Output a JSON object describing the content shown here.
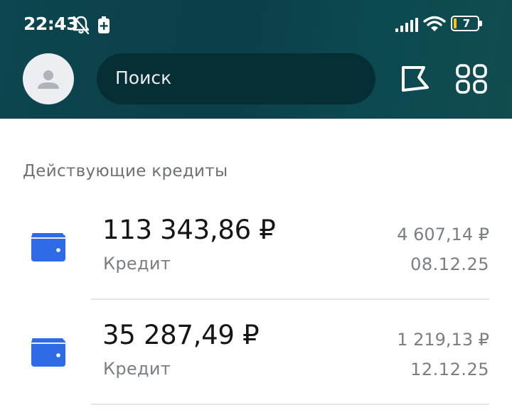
{
  "status_bar": {
    "time": "22:43",
    "battery_level": "7",
    "icons": [
      "bell-off-icon",
      "battery-saver-icon",
      "signal-icon",
      "wifi-icon",
      "battery-icon"
    ],
    "battery_fill_color": "#f5c518"
  },
  "header": {
    "avatar_icon": "person-icon",
    "search": {
      "placeholder": "Поиск"
    },
    "actions": [
      "flag-icon",
      "grid-icon"
    ],
    "background_color": "#0b3f49"
  },
  "section": {
    "title": "Действующие кредиты"
  },
  "credits": [
    {
      "icon": "wallet-icon",
      "amount": "113 343,86 ₽",
      "type": "Кредит",
      "payment": "4 607,14 ₽",
      "date": "08.12.25"
    },
    {
      "icon": "wallet-icon",
      "amount": "35 287,49 ₽",
      "type": "Кредит",
      "payment": "1 219,13 ₽",
      "date": "12.12.25"
    }
  ],
  "colors": {
    "accent": "#2f6be6",
    "secondary_text": "#7a7f83",
    "primary_text": "#151515"
  }
}
